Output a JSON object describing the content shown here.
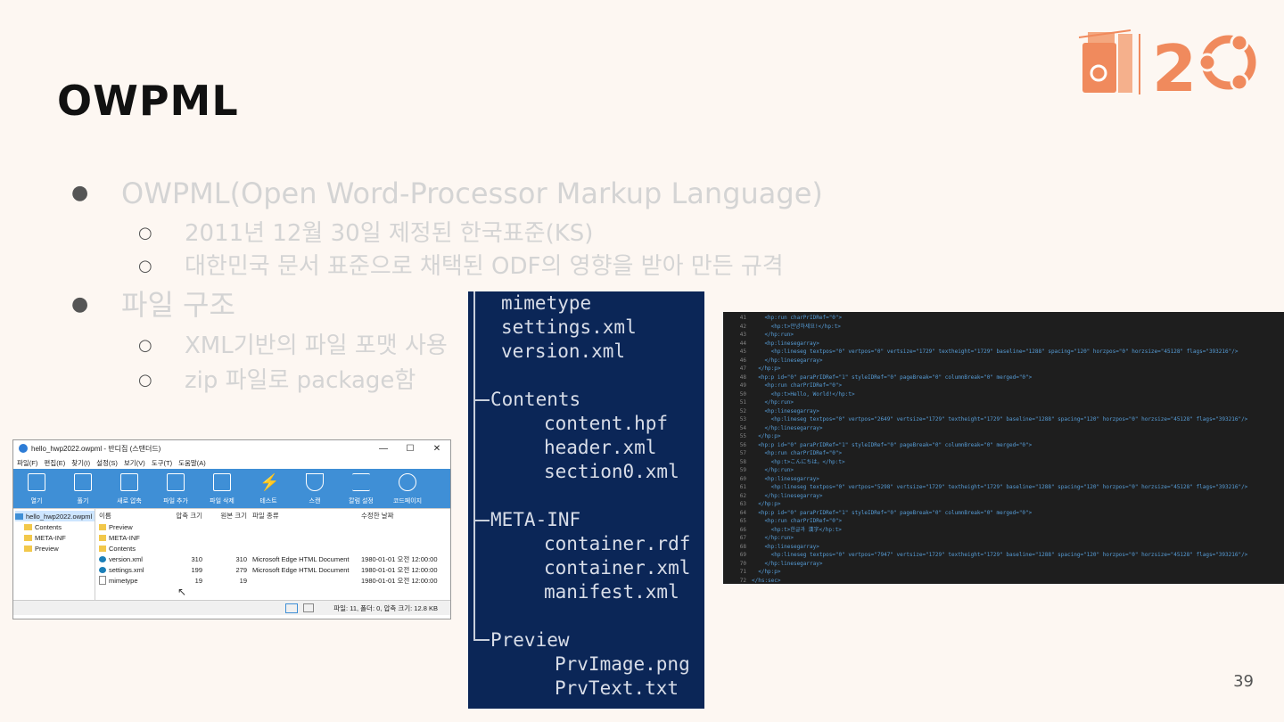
{
  "slide": {
    "title": "OWPML",
    "page_number": "39",
    "bullets": [
      {
        "text": "OWPML(Open Word-Processor Markup Language)",
        "level": 1
      },
      {
        "text": "2011년 12월 30일 제정된 한국표준(KS)",
        "level": 2
      },
      {
        "text": "대한민국 문서 표준으로 채택된 ODF의 영향을 받아 만든 규격",
        "level": 2
      },
      {
        "text": "파일 구조",
        "level": 1
      },
      {
        "text": "XML기반의 파일 포맷 사용",
        "level": 2
      },
      {
        "text": "zip 파일로 package함",
        "level": 2
      }
    ],
    "bullet_glyphs": {
      "level1": "●",
      "level2": "○"
    }
  },
  "logo": {
    "number": "2",
    "accent": "#f08a5d"
  },
  "window": {
    "title": "hello_hwp2022.owpml - 반디집 (스탠더드)",
    "controls": {
      "minimize": "—",
      "maximize": "☐",
      "close": "✕"
    },
    "menu": [
      "파일(F)",
      "편집(E)",
      "찾기(I)",
      "설정(S)",
      "보기(V)",
      "도구(T)",
      "도움말(A)"
    ],
    "toolbar": [
      "열기",
      "풀기",
      "새로 압축",
      "파일 추가",
      "파일 삭제",
      "테스트",
      "스캔",
      "칼럼 설정",
      "코드페이지"
    ],
    "tree": [
      {
        "label": "hello_hwp2022.owpml",
        "selected": true
      },
      {
        "label": "Contents"
      },
      {
        "label": "META-INF"
      },
      {
        "label": "Preview"
      }
    ],
    "columns": [
      "이름",
      "압축 크기",
      "원본 크기",
      "파일 종류",
      "수정한 날짜"
    ],
    "rows": [
      {
        "name": "Preview",
        "icon": "folder-icon",
        "packed": "",
        "orig": "",
        "type": "",
        "date": ""
      },
      {
        "name": "META-INF",
        "icon": "folder-icon",
        "packed": "",
        "orig": "",
        "type": "",
        "date": ""
      },
      {
        "name": "Contents",
        "icon": "folder-icon",
        "packed": "",
        "orig": "",
        "type": "",
        "date": ""
      },
      {
        "name": "version.xml",
        "icon": "edge-icon",
        "packed": "310",
        "orig": "310",
        "type": "Microsoft Edge HTML Document",
        "date": "1980-01-01 오전 12:00:00"
      },
      {
        "name": "settings.xml",
        "icon": "edge-icon",
        "packed": "199",
        "orig": "279",
        "type": "Microsoft Edge HTML Document",
        "date": "1980-01-01 오전 12:00:00"
      },
      {
        "name": "mimetype",
        "icon": "doc-icon",
        "packed": "19",
        "orig": "19",
        "type": "",
        "date": "1980-01-01 오전 12:00:00"
      }
    ],
    "status": "파일: 11, 폴더: 0, 압축 크기: 12.8 KB"
  },
  "tree_panel": {
    "lines": [
      {
        "text": "mimetype",
        "indent": 1
      },
      {
        "text": "settings.xml",
        "indent": 1
      },
      {
        "text": "version.xml",
        "indent": 1
      },
      {
        "text": "Contents",
        "indent": 0
      },
      {
        "text": "content.hpf",
        "indent": 2
      },
      {
        "text": "header.xml",
        "indent": 2
      },
      {
        "text": "section0.xml",
        "indent": 2
      },
      {
        "text": "META-INF",
        "indent": 0
      },
      {
        "text": "container.rdf",
        "indent": 2
      },
      {
        "text": "container.xml",
        "indent": 2
      },
      {
        "text": "manifest.xml",
        "indent": 2
      },
      {
        "text": "Preview",
        "indent": 0
      },
      {
        "text": "PrvImage.png",
        "indent": 2
      },
      {
        "text": "PrvText.txt",
        "indent": 2
      }
    ]
  },
  "code_panel": {
    "lines": [
      {
        "n": "41",
        "code": "    <hp:run charPrIDRef=\"0\">"
      },
      {
        "n": "42",
        "code": "      <hp:t>안녕하세요!</hp:t>"
      },
      {
        "n": "43",
        "code": "    </hp:run>"
      },
      {
        "n": "44",
        "code": "    <hp:linesegarray>"
      },
      {
        "n": "45",
        "code": "      <hp:lineseg textpos=\"0\" vertpos=\"0\" vertsize=\"1729\" textheight=\"1729\" baseline=\"1288\" spacing=\"120\" horzpos=\"0\" horzsize=\"45128\" flags=\"393216\"/>"
      },
      {
        "n": "46",
        "code": "    </hp:linesegarray>"
      },
      {
        "n": "47",
        "code": "  </hp:p>"
      },
      {
        "n": "48",
        "code": "  <hp:p id=\"0\" paraPrIDRef=\"1\" styleIDRef=\"0\" pageBreak=\"0\" columnBreak=\"0\" merged=\"0\">"
      },
      {
        "n": "49",
        "code": "    <hp:run charPrIDRef=\"0\">"
      },
      {
        "n": "50",
        "code": "      <hp:t>Hello, World!</hp:t>"
      },
      {
        "n": "51",
        "code": "    </hp:run>"
      },
      {
        "n": "52",
        "code": "    <hp:linesegarray>"
      },
      {
        "n": "53",
        "code": "      <hp:lineseg textpos=\"0\" vertpos=\"2649\" vertsize=\"1729\" textheight=\"1729\" baseline=\"1288\" spacing=\"120\" horzpos=\"0\" horzsize=\"45128\" flags=\"393216\"/>"
      },
      {
        "n": "54",
        "code": "    </hp:linesegarray>"
      },
      {
        "n": "55",
        "code": "  </hp:p>"
      },
      {
        "n": "56",
        "code": "  <hp:p id=\"0\" paraPrIDRef=\"1\" styleIDRef=\"0\" pageBreak=\"0\" columnBreak=\"0\" merged=\"0\">"
      },
      {
        "n": "57",
        "code": "    <hp:run charPrIDRef=\"0\">"
      },
      {
        "n": "58",
        "code": "      <hp:t>こんにちは。</hp:t>"
      },
      {
        "n": "59",
        "code": "    </hp:run>"
      },
      {
        "n": "60",
        "code": "    <hp:linesegarray>"
      },
      {
        "n": "61",
        "code": "      <hp:lineseg textpos=\"0\" vertpos=\"5298\" vertsize=\"1729\" textheight=\"1729\" baseline=\"1288\" spacing=\"120\" horzpos=\"0\" horzsize=\"45128\" flags=\"393216\"/>"
      },
      {
        "n": "62",
        "code": "    </hp:linesegarray>"
      },
      {
        "n": "63",
        "code": "  </hp:p>"
      },
      {
        "n": "64",
        "code": "  <hp:p id=\"0\" paraPrIDRef=\"1\" styleIDRef=\"0\" pageBreak=\"0\" columnBreak=\"0\" merged=\"0\">"
      },
      {
        "n": "65",
        "code": "    <hp:run charPrIDRef=\"0\">"
      },
      {
        "n": "66",
        "code": "      <hp:t>한글과 漢字</hp:t>"
      },
      {
        "n": "67",
        "code": "    </hp:run>"
      },
      {
        "n": "68",
        "code": "    <hp:linesegarray>"
      },
      {
        "n": "69",
        "code": "      <hp:lineseg textpos=\"0\" vertpos=\"7947\" vertsize=\"1729\" textheight=\"1729\" baseline=\"1288\" spacing=\"120\" horzpos=\"0\" horzsize=\"45128\" flags=\"393216\"/>"
      },
      {
        "n": "70",
        "code": "    </hp:linesegarray>"
      },
      {
        "n": "71",
        "code": "  </hp:p>"
      },
      {
        "n": "72",
        "code": "</hs:sec>"
      }
    ]
  }
}
